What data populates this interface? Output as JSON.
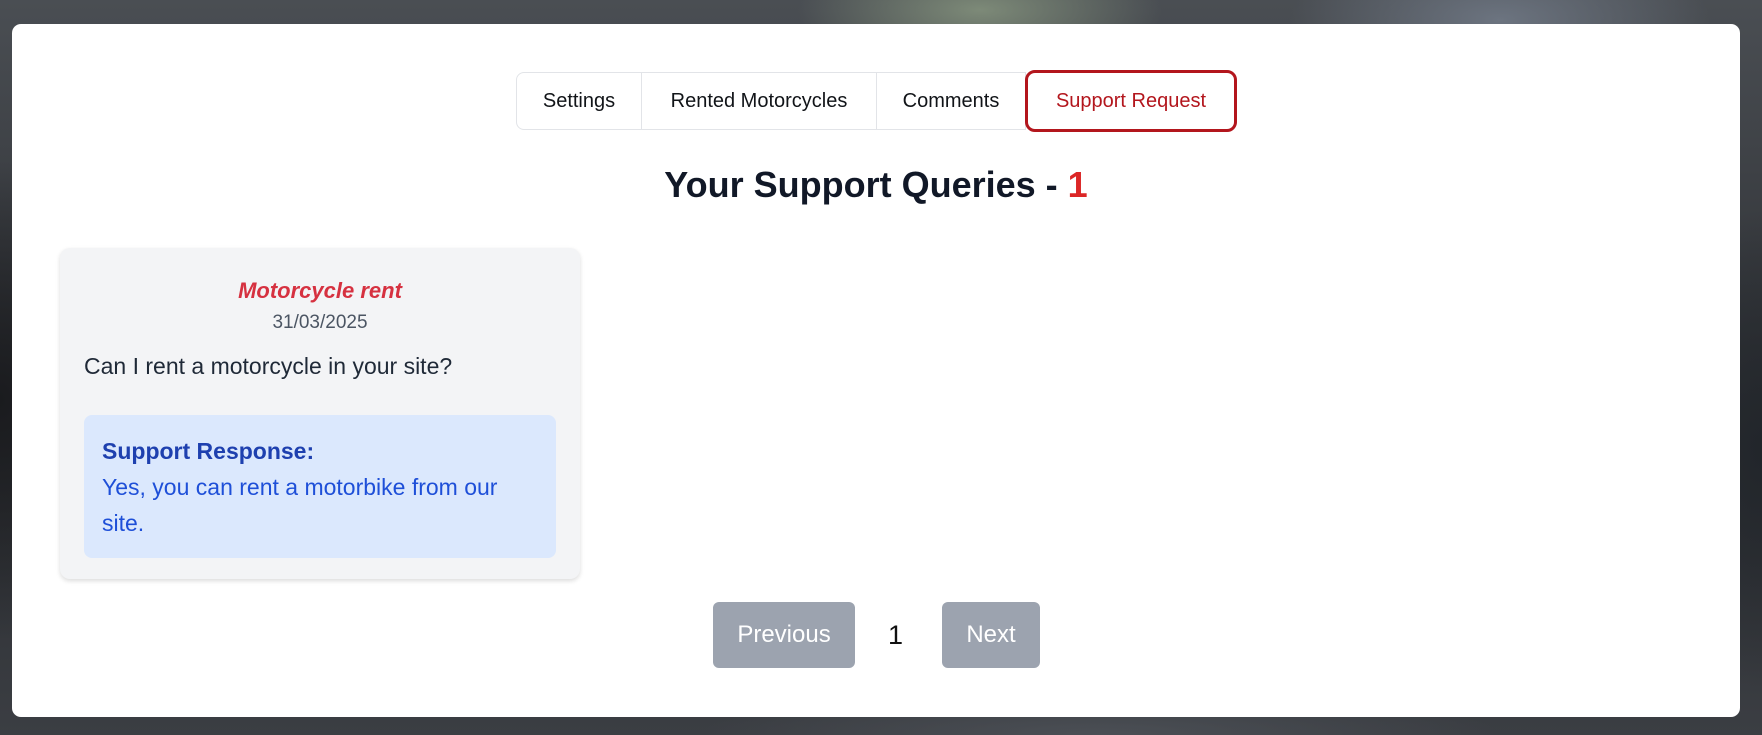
{
  "tabs": {
    "settings": "Settings",
    "rented": "Rented Motorcycles",
    "comments": "Comments",
    "support": "Support Request"
  },
  "heading": {
    "prefix": "Your Support Queries - ",
    "count": "1"
  },
  "queries": [
    {
      "subject": "Motorcycle rent",
      "date": "31/03/2025",
      "question": "Can I rent a motorcycle in your site?",
      "response_label": "Support Response:",
      "response_text": "Yes, you can rent a motorbike from our site."
    }
  ],
  "pagination": {
    "previous": "Previous",
    "current_page": "1",
    "next": "Next"
  },
  "colors": {
    "accent_red": "#b3161d",
    "count_red": "#dc2626",
    "response_bg": "#dbe8fd",
    "disabled_button": "#9ca3af"
  }
}
